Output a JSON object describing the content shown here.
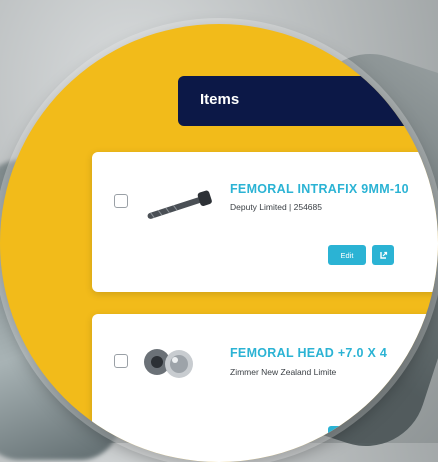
{
  "header": {
    "title": "Items"
  },
  "items": [
    {
      "title": "FEMORAL INTRAFIX 9MM-10",
      "subtitle": "Deputy Limited | 254685",
      "edit_label": "Edit",
      "export_icon": "export-icon"
    },
    {
      "title": "FEMORAL HEAD +7.0 X 4",
      "subtitle": "Zimmer New Zealand Limite"
    }
  ],
  "colors": {
    "accent": "#2bb3d4",
    "header": "#0c1847",
    "background_frame": "#f2bb1a"
  }
}
